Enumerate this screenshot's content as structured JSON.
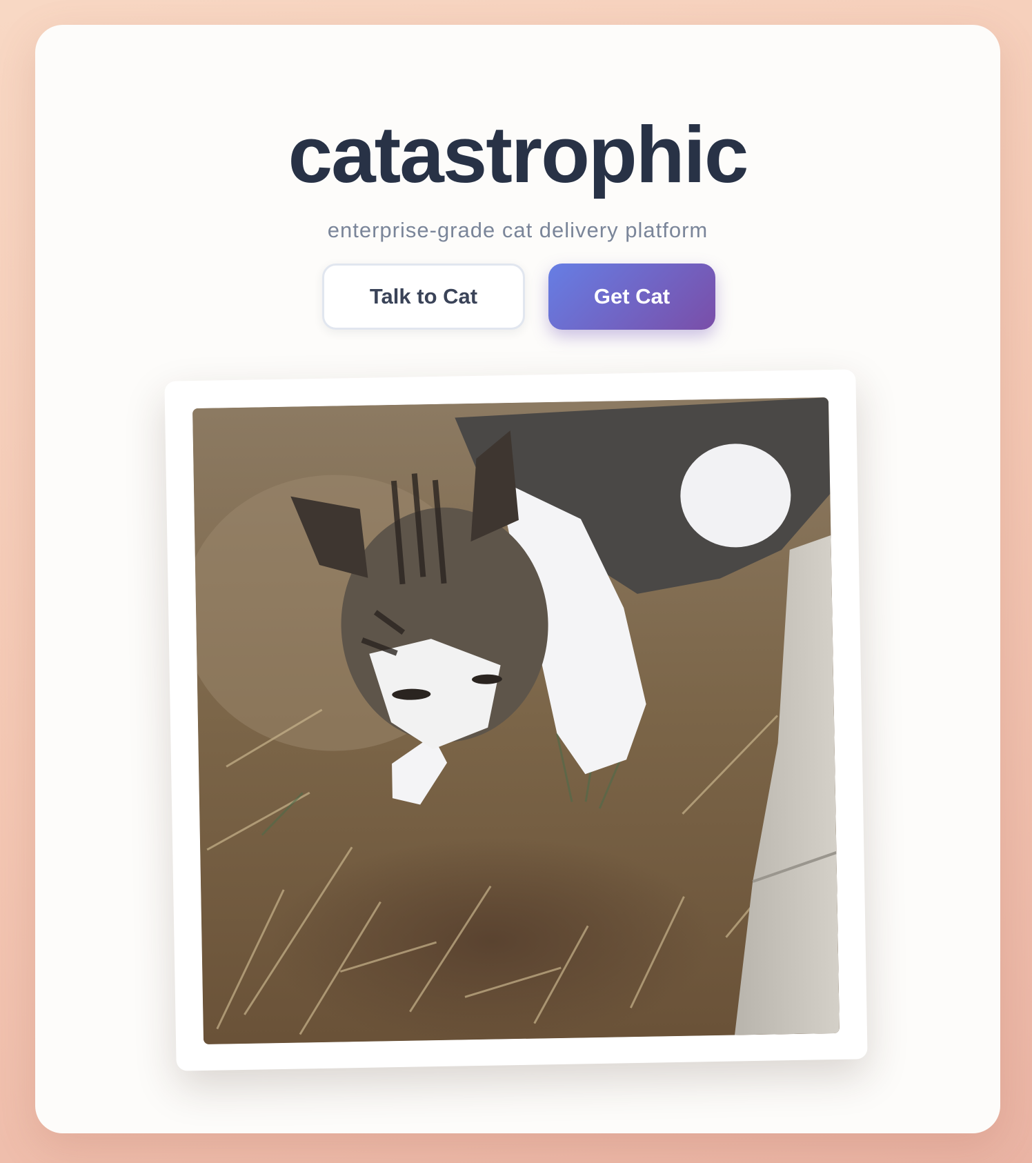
{
  "header": {
    "title": "catastrophic",
    "subtitle": "enterprise-grade cat delivery platform"
  },
  "actions": {
    "talk_label": "Talk to Cat",
    "get_label": "Get Cat"
  },
  "photo": {
    "alt": "cat photo",
    "subject": "tabby and white cat sniffing dry grass"
  },
  "colors": {
    "title": "#283246",
    "subtitle": "#7a8599",
    "primary_start": "#667ee4",
    "primary_end": "#7a4ea8",
    "background": "#f4c8b4"
  }
}
